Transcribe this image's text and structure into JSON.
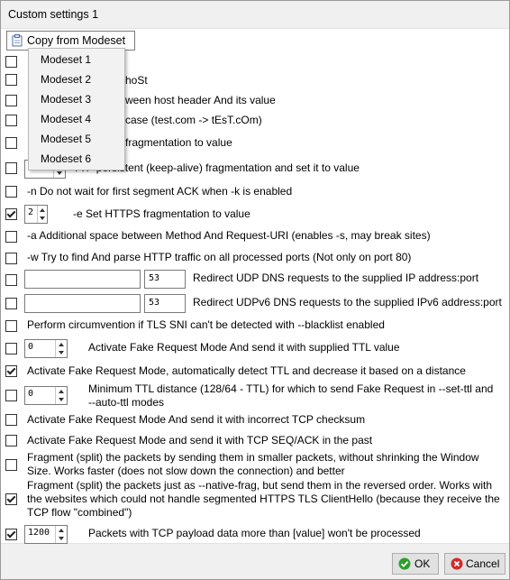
{
  "window": {
    "title": "Custom settings 1"
  },
  "copy_button": {
    "label": "Copy from Modeset"
  },
  "modesets": [
    "Modeset 1",
    "Modeset 2",
    "Modeset 3",
    "Modeset 4",
    "Modeset 5",
    "Modeset 6"
  ],
  "partial_labels": [
    "hoSt",
    "ween host header And its value",
    "case (test.com -> tEsT.cOm)",
    "fragmentation to value"
  ],
  "options": [
    {
      "label": "TTP persistent (keep-alive) fragmentation and set it to value",
      "checked": false
    },
    {
      "label": "-n Do not wait for first segment ACK when -k is enabled",
      "checked": false
    },
    {
      "label": "-e Set HTTPS fragmentation to value",
      "checked": true,
      "value": "2"
    },
    {
      "label": "-a Additional space between Method And Request-URI (enables -s, may break sites)",
      "checked": false
    },
    {
      "label": "-w Try to find And parse HTTP traffic on all processed ports (Not only on port 80)",
      "checked": false
    },
    {
      "label": "Redirect UDP DNS requests to the supplied IP address:port",
      "checked": false,
      "ip": "",
      "port": "53"
    },
    {
      "label": "Redirect UDPv6 DNS requests to the supplied IPv6 address:port",
      "checked": false,
      "ip": "",
      "port": "53"
    },
    {
      "label": "Perform circumvention if TLS SNI can't be detected with --blacklist enabled",
      "checked": false
    },
    {
      "label": "Activate Fake Request Mode And send it with supplied TTL value",
      "checked": false,
      "value": "0"
    },
    {
      "label": "Activate Fake Request Mode, automatically detect TTL and decrease it based on a distance",
      "checked": true
    },
    {
      "label": "Minimum TTL distance (128/64 - TTL) for which to send Fake Request in --set-ttl and --auto-ttl modes",
      "checked": false,
      "value": "0"
    },
    {
      "label": "Activate Fake Request Mode And send it with incorrect TCP checksum",
      "checked": false
    },
    {
      "label": "Activate Fake Request Mode and send it with TCP SEQ/ACK in the past",
      "checked": false
    },
    {
      "label": "Fragment (split) the packets by sending them in smaller packets, without  shrinking the Window Size. Works faster (does not slow down the connection) and better",
      "checked": false
    },
    {
      "label": "Fragment (split) the packets just as --native-frag, but send them in the reversed order. Works with the websites which could not handle segmented HTTPS TLS ClientHello (because they receive the TCP flow \"combined\")",
      "checked": true
    },
    {
      "label": "Packets with TCP payload data more than [value] won't be processed",
      "checked": true,
      "value": "1200"
    }
  ],
  "ok_button": {
    "label": "OK"
  },
  "cancel_button": {
    "label": "Cancel"
  },
  "colors": {
    "ok_check": "#2e9e2e",
    "cancel_x": "#d12a2a",
    "accent": "#0078d7"
  }
}
